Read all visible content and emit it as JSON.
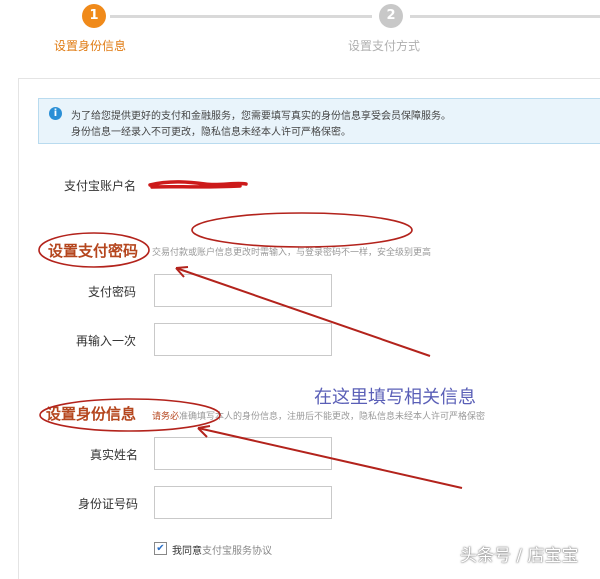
{
  "steps": [
    {
      "number": "1",
      "label": "设置身份信息",
      "state": "active"
    },
    {
      "number": "2",
      "label": "设置支付方式",
      "state": "inactive"
    }
  ],
  "notice": {
    "line1": "为了给您提供更好的支付和金融服务，您需要填写真实的身份信息享受会员保障服务。",
    "line2": "身份信息一经录入不可更改，隐私信息未经本人许可严格保密。"
  },
  "account": {
    "label": "支付宝账户名"
  },
  "password_section": {
    "title": "设置支付密码",
    "hint": "交易付款或账户信息更改时需输入，与登录密码不一样，安全级别更高",
    "password_label": "支付密码",
    "confirm_label": "再输入一次"
  },
  "identity_section": {
    "title": "设置身份信息",
    "hint_lead": "请务必",
    "hint": "准确填写本人的身份信息，注册后不能更改，隐私信息未经本人许可严格保密",
    "name_label": "真实姓名",
    "id_label": "身份证号码"
  },
  "agreement": {
    "checked": true,
    "text": "我同意",
    "link": "支付宝服务协议"
  },
  "annotation": "在这里填写相关信息",
  "watermark": "头条号 / 店宝宝",
  "colors": {
    "accent": "#f08a1a",
    "annotation_red": "#b3231c",
    "section_title": "#b5461e"
  }
}
